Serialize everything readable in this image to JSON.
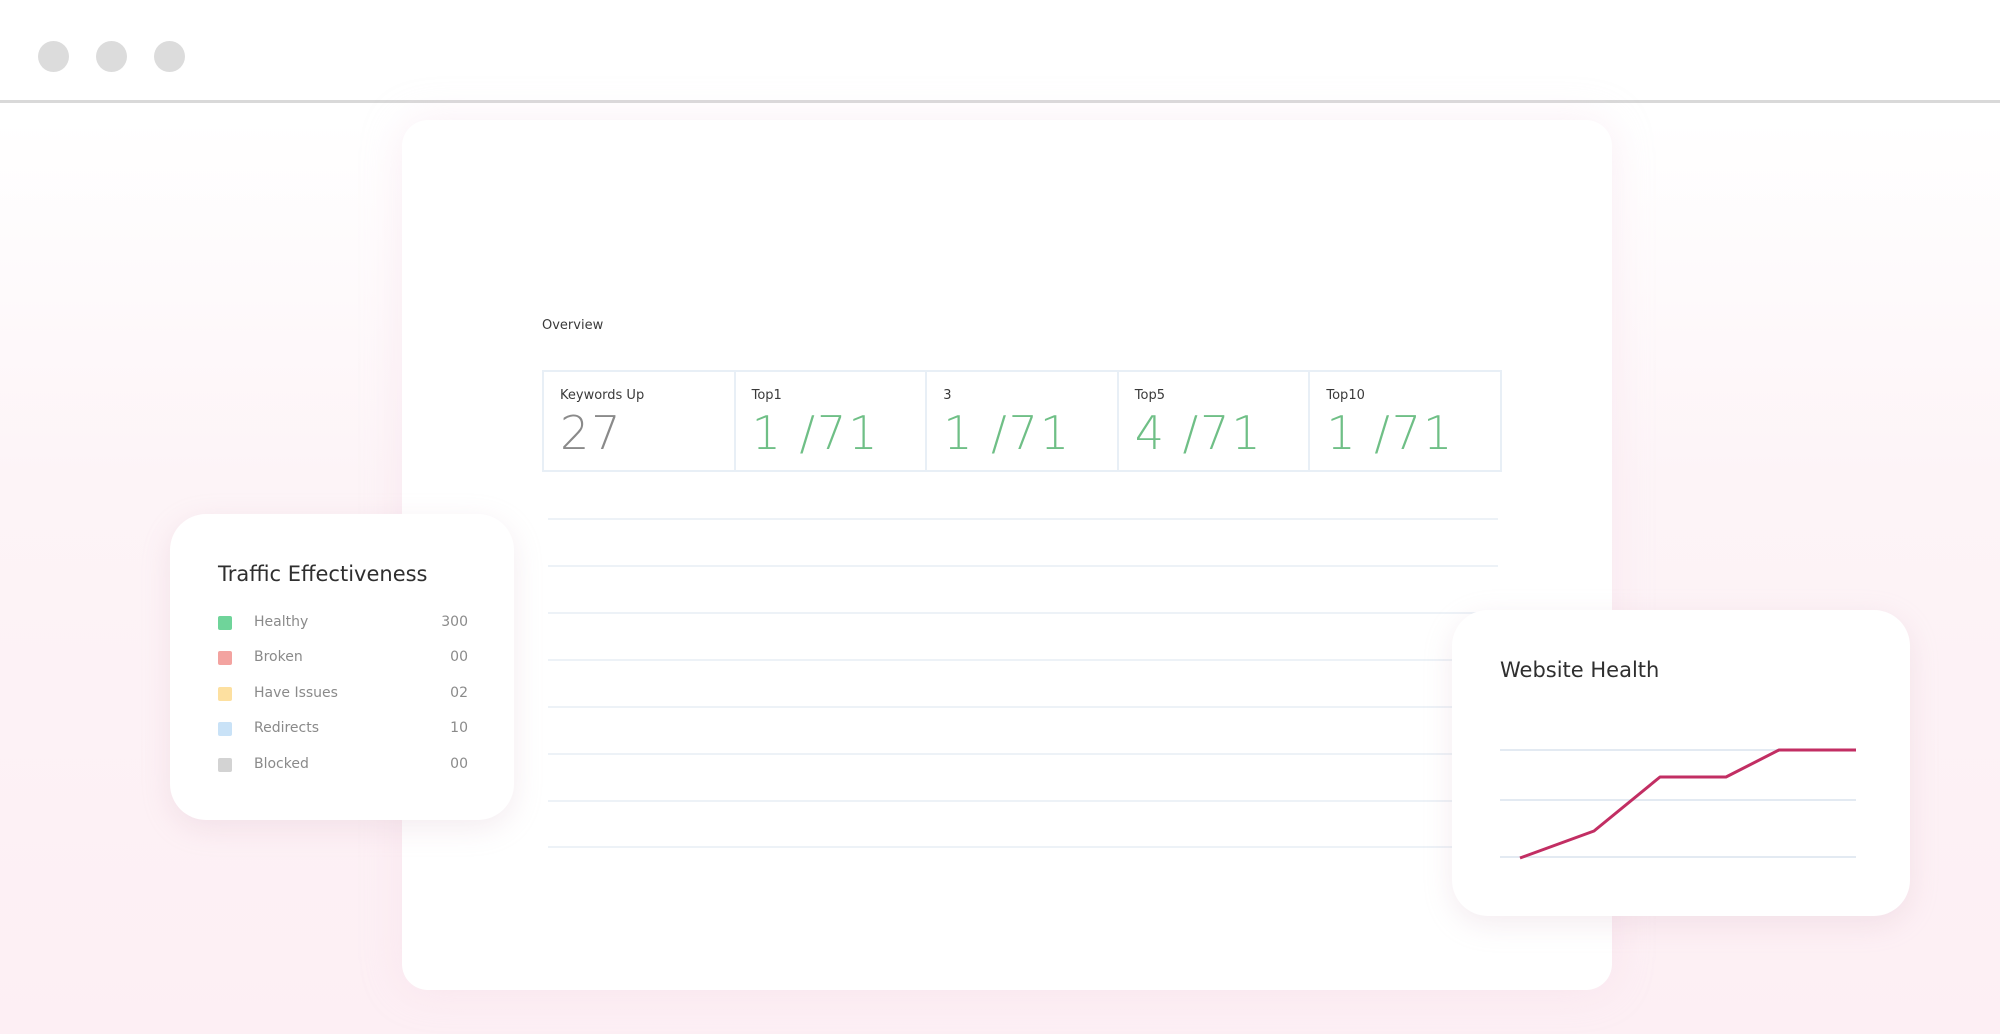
{
  "window": {
    "controls": [
      "close-dot",
      "minimize-dot",
      "maximize-dot"
    ]
  },
  "overview": {
    "label": "Overview",
    "stats": [
      {
        "label": "Keywords Up",
        "value": "27"
      },
      {
        "label": "Top1",
        "value": "1 /71"
      },
      {
        "label": "3",
        "value": "1 /71"
      },
      {
        "label": "Top5",
        "value": "4 /71"
      },
      {
        "label": "Top10",
        "value": "1 /71"
      }
    ]
  },
  "traffic": {
    "title": "Traffic Effectiveness",
    "items": [
      {
        "label": "Healthy",
        "value": "300",
        "color": "#6fd49a"
      },
      {
        "label": "Broken",
        "value": "00",
        "color": "#f3a3a0"
      },
      {
        "label": "Have Issues",
        "value": "02",
        "color": "#fde0a0"
      },
      {
        "label": "Redirects",
        "value": "10",
        "color": "#c9e2f7"
      },
      {
        "label": "Blocked",
        "value": "00",
        "color": "#d3d3d3"
      }
    ]
  },
  "health": {
    "title": "Website Health",
    "line_color": "#c22e63",
    "values": [
      0,
      1,
      3,
      3,
      4,
      4
    ]
  },
  "colors": {
    "accent_green": "#6fbf86",
    "grid_line": "#e8eff6"
  }
}
